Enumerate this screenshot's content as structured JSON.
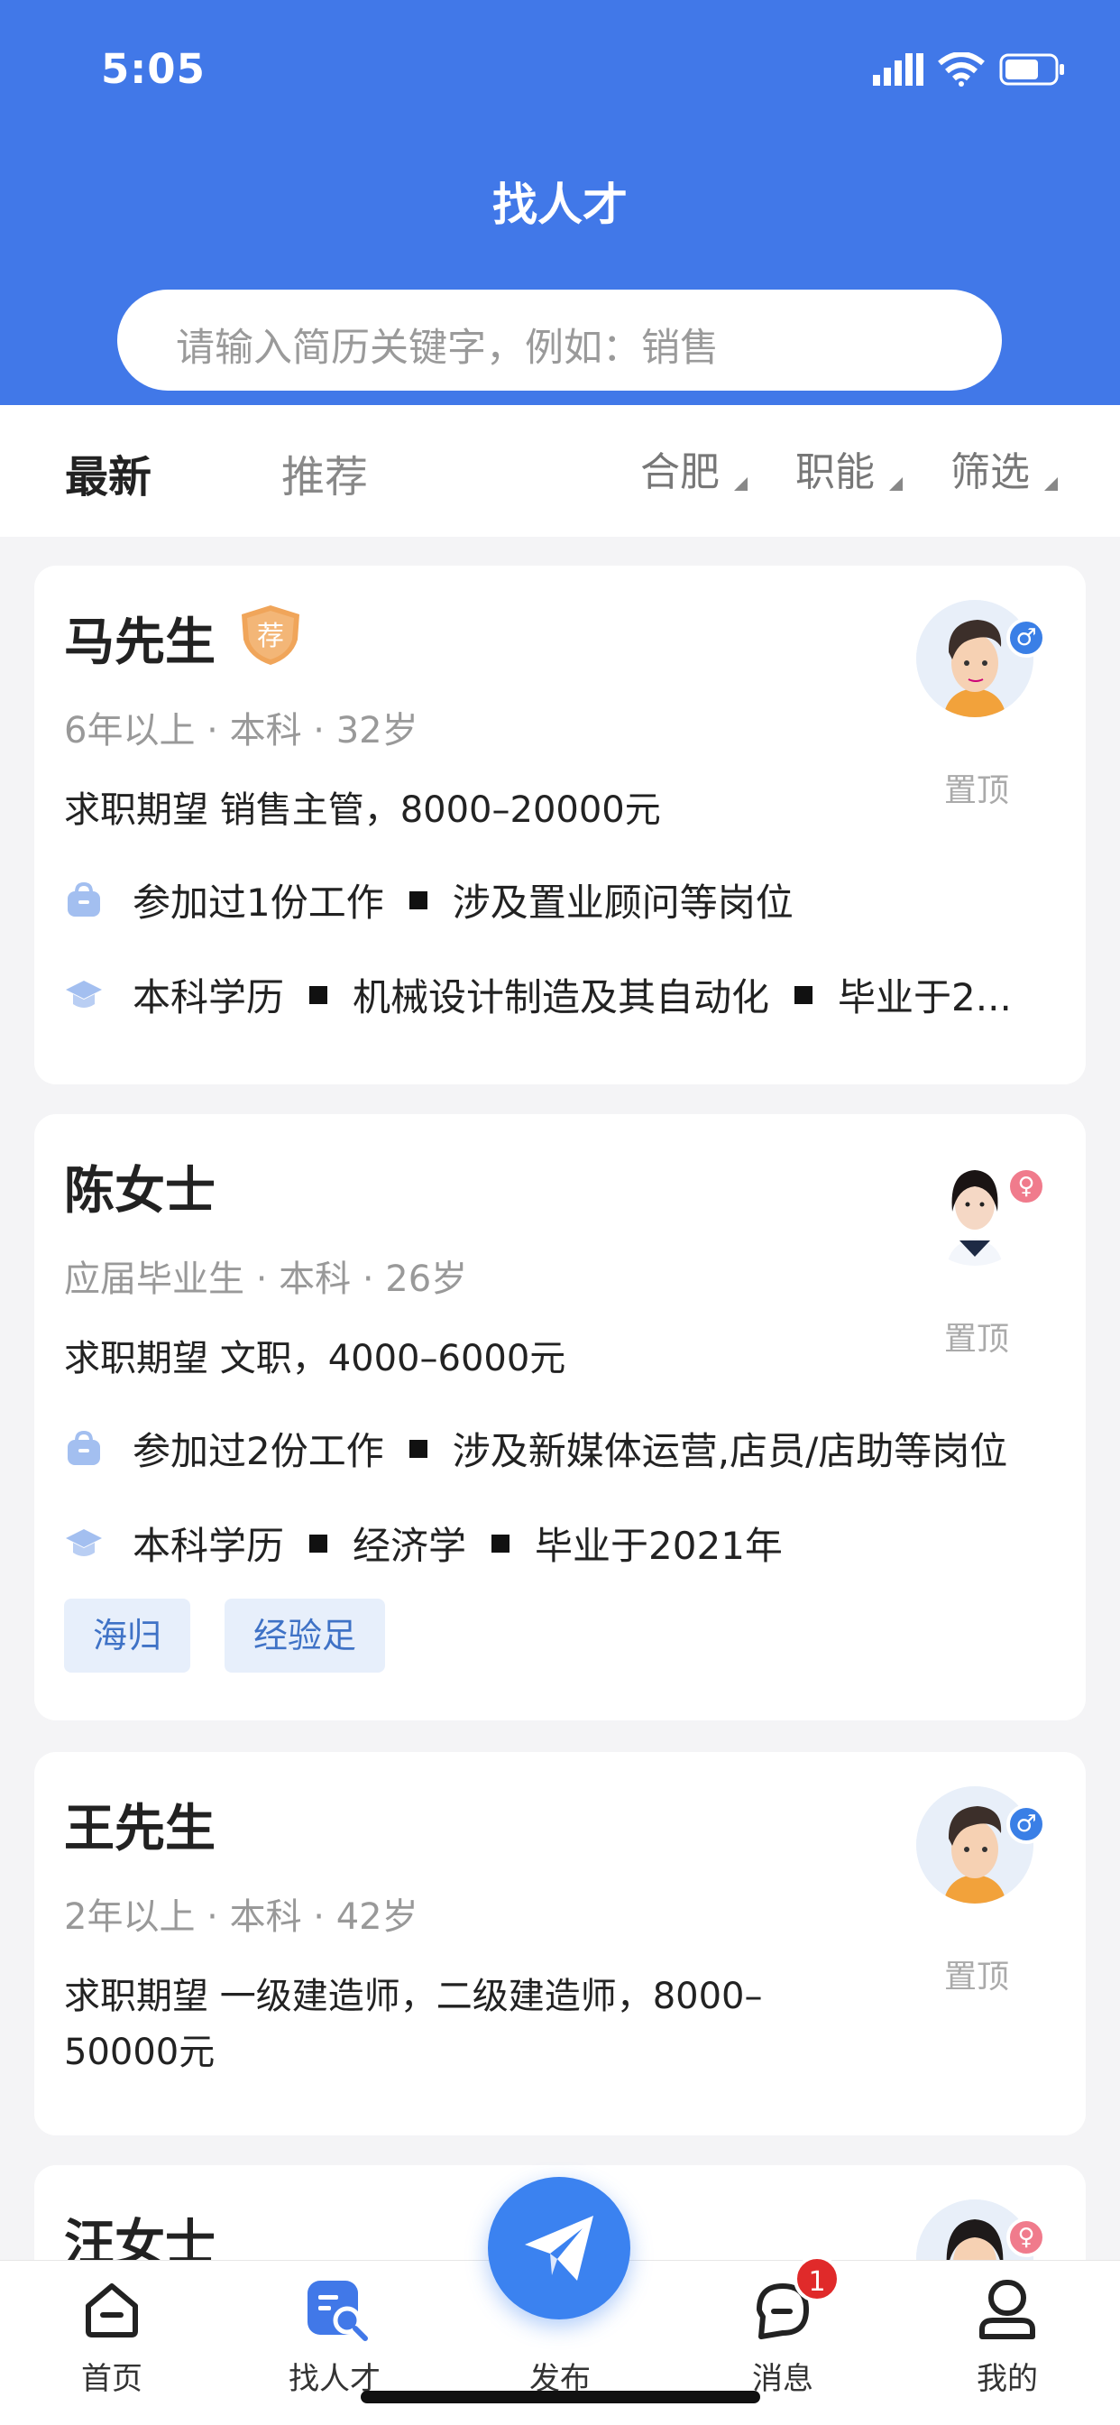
{
  "status": {
    "time": "5:05"
  },
  "header": {
    "title": "找人才",
    "search_placeholder": "请输入简历关键字，例如：销售"
  },
  "tabs": [
    {
      "label": "最新"
    },
    {
      "label": "推荐"
    }
  ],
  "filters": [
    {
      "label": "合肥"
    },
    {
      "label": "职能"
    },
    {
      "label": "筛选"
    }
  ],
  "candidates": [
    {
      "name": "马先生",
      "badge": "荐",
      "meta": "6年以上 · 本科 · 32岁",
      "expect": "求职期望 销售主管，8000–20000元",
      "work": [
        "参加过1份工作",
        "涉及置业顾问等岗位"
      ],
      "edu": [
        "本科学历",
        "机械设计制造及其自动化",
        "毕业于2..."
      ],
      "pin": "置顶",
      "gender": "male"
    },
    {
      "name": "陈女士",
      "meta": "应届毕业生 · 本科 · 26岁",
      "expect": "求职期望 文职，4000–6000元",
      "work": [
        "参加过2份工作",
        "涉及新媒体运营,店员/店助等岗位"
      ],
      "edu": [
        "本科学历",
        "经济学",
        "毕业于2021年"
      ],
      "tags": [
        "海归",
        "经验足"
      ],
      "pin": "置顶",
      "gender": "female"
    },
    {
      "name": "王先生",
      "meta": "2年以上 · 本科 · 42岁",
      "expect_line1": "求职期望 一级建造师，二级建造师，8000–",
      "expect_line2": "50000元",
      "pin": "置顶",
      "gender": "male"
    },
    {
      "name": "汪女士",
      "gender": "female"
    }
  ],
  "tabbar": {
    "items": [
      {
        "label": "首页"
      },
      {
        "label": "找人才"
      },
      {
        "label": "发布"
      },
      {
        "label": "消息"
      },
      {
        "label": "我的"
      }
    ],
    "message_badge": "1",
    "active_color": "#4178e8"
  },
  "colors": {
    "primary": "#4178e8",
    "tag_bg": "#e7effb",
    "badge": "#e02a2a"
  }
}
